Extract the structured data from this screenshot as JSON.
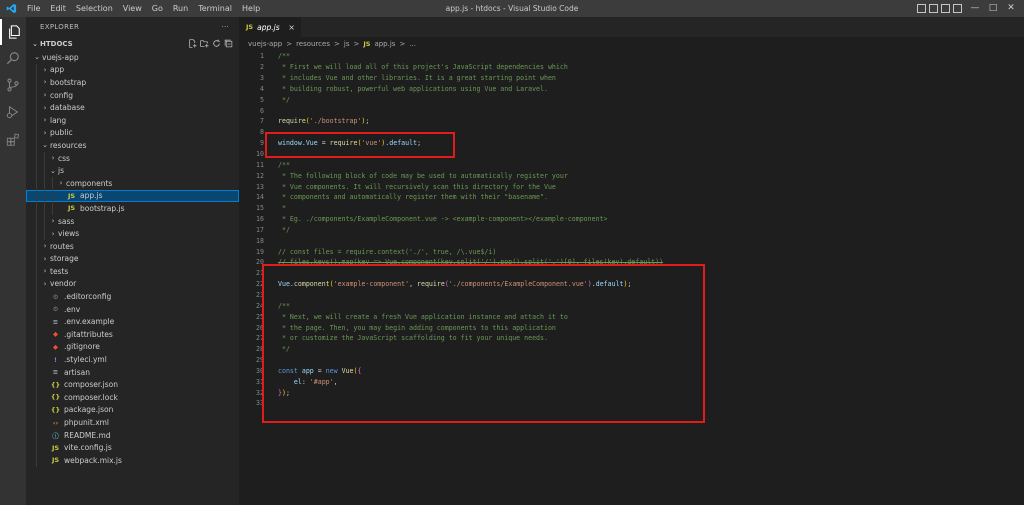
{
  "titlebar": {
    "menu": [
      "File",
      "Edit",
      "Selection",
      "View",
      "Go",
      "Run",
      "Terminal",
      "Help"
    ],
    "window_title": "app.js - htdocs - Visual Studio Code",
    "controls": [
      "—",
      "□",
      "✕"
    ]
  },
  "sidebar": {
    "header": "EXPLORER",
    "more": "···",
    "folder": "HTDOCS",
    "tree": [
      {
        "label": "vuejs-app",
        "depth": 0,
        "type": "folder",
        "open": true
      },
      {
        "label": "app",
        "depth": 1,
        "type": "folder",
        "open": false
      },
      {
        "label": "bootstrap",
        "depth": 1,
        "type": "folder",
        "open": false
      },
      {
        "label": "config",
        "depth": 1,
        "type": "folder",
        "open": false
      },
      {
        "label": "database",
        "depth": 1,
        "type": "folder",
        "open": false
      },
      {
        "label": "lang",
        "depth": 1,
        "type": "folder",
        "open": false
      },
      {
        "label": "public",
        "depth": 1,
        "type": "folder",
        "open": false
      },
      {
        "label": "resources",
        "depth": 1,
        "type": "folder",
        "open": true
      },
      {
        "label": "css",
        "depth": 2,
        "type": "folder",
        "open": false
      },
      {
        "label": "js",
        "depth": 2,
        "type": "folder",
        "open": true
      },
      {
        "label": "components",
        "depth": 3,
        "type": "folder",
        "open": false
      },
      {
        "label": "app.js",
        "depth": 3,
        "type": "js",
        "selected": true
      },
      {
        "label": "bootstrap.js",
        "depth": 3,
        "type": "js"
      },
      {
        "label": "sass",
        "depth": 2,
        "type": "folder",
        "open": false
      },
      {
        "label": "views",
        "depth": 2,
        "type": "folder",
        "open": false
      },
      {
        "label": "routes",
        "depth": 1,
        "type": "folder",
        "open": false
      },
      {
        "label": "storage",
        "depth": 1,
        "type": "folder",
        "open": false
      },
      {
        "label": "tests",
        "depth": 1,
        "type": "folder",
        "open": false
      },
      {
        "label": "vendor",
        "depth": 1,
        "type": "folder",
        "open": false
      },
      {
        "label": ".editorconfig",
        "depth": 1,
        "type": "gear"
      },
      {
        "label": ".env",
        "depth": 1,
        "type": "gear"
      },
      {
        "label": ".env.example",
        "depth": 1,
        "type": "lines"
      },
      {
        "label": ".gitattributes",
        "depth": 1,
        "type": "git"
      },
      {
        "label": ".gitignore",
        "depth": 1,
        "type": "git"
      },
      {
        "label": ".styleci.yml",
        "depth": 1,
        "type": "yml"
      },
      {
        "label": "artisan",
        "depth": 1,
        "type": "lines"
      },
      {
        "label": "composer.json",
        "depth": 1,
        "type": "json"
      },
      {
        "label": "composer.lock",
        "depth": 1,
        "type": "json"
      },
      {
        "label": "package.json",
        "depth": 1,
        "type": "json"
      },
      {
        "label": "phpunit.xml",
        "depth": 1,
        "type": "xml"
      },
      {
        "label": "README.md",
        "depth": 1,
        "type": "info"
      },
      {
        "label": "vite.config.js",
        "depth": 1,
        "type": "js"
      },
      {
        "label": "webpack.mix.js",
        "depth": 1,
        "type": "js"
      }
    ]
  },
  "editor": {
    "tab": {
      "icon": "JS",
      "label": "app.js",
      "close": "×"
    },
    "breadcrumb": [
      "vuejs-app",
      ">",
      "resources",
      ">",
      "js",
      ">",
      "JS",
      "app.js",
      ">",
      "..."
    ],
    "lines": [
      [
        [
          "c",
          "/**"
        ]
      ],
      [
        [
          "c",
          " * First we will load all of this project's JavaScript dependencies which"
        ]
      ],
      [
        [
          "c",
          " * includes Vue and other libraries. It is a great starting point when"
        ]
      ],
      [
        [
          "c",
          " * building robust, powerful web applications using Vue and Laravel."
        ]
      ],
      [
        [
          "c",
          " */"
        ]
      ],
      [],
      [
        [
          "f",
          "require"
        ],
        [
          "y",
          "("
        ],
        [
          "s",
          "'./bootstrap'"
        ],
        [
          "y",
          ")"
        ],
        [
          "p",
          ";"
        ]
      ],
      [],
      [
        [
          "v",
          "window"
        ],
        [
          "p",
          "."
        ],
        [
          "v",
          "Vue"
        ],
        [
          "p",
          " = "
        ],
        [
          "f",
          "require"
        ],
        [
          "y",
          "("
        ],
        [
          "s",
          "'vue'"
        ],
        [
          "y",
          ")"
        ],
        [
          "p",
          "."
        ],
        [
          "v",
          "default"
        ],
        [
          "p",
          ";"
        ]
      ],
      [],
      [
        [
          "c",
          "/**"
        ]
      ],
      [
        [
          "c",
          " * The following block of code may be used to automatically register your"
        ]
      ],
      [
        [
          "c",
          " * Vue components. It will recursively scan this directory for the Vue"
        ]
      ],
      [
        [
          "c",
          " * components and automatically register them with their \"basename\"."
        ]
      ],
      [
        [
          "c",
          " *"
        ]
      ],
      [
        [
          "c",
          " * Eg. ./components/ExampleComponent.vue -> <example-component></example-component>"
        ]
      ],
      [
        [
          "c",
          " */"
        ]
      ],
      [],
      [
        [
          "c",
          "// const files = require.context('./', true, /\\.vue$/i)"
        ]
      ],
      [
        [
          "cs",
          "// files.keys().map(key => Vue.component(key.split('/').pop().split('.')[0], files(key).default))"
        ]
      ],
      [],
      [
        [
          "v",
          "Vue"
        ],
        [
          "p",
          "."
        ],
        [
          "f",
          "component"
        ],
        [
          "y",
          "("
        ],
        [
          "s",
          "'example-component'"
        ],
        [
          "p",
          ", "
        ],
        [
          "f",
          "require"
        ],
        [
          "m",
          "("
        ],
        [
          "s",
          "'./components/ExampleComponent.vue'"
        ],
        [
          "m",
          ")"
        ],
        [
          "p",
          "."
        ],
        [
          "v",
          "default"
        ],
        [
          "y",
          ")"
        ],
        [
          "p",
          ";"
        ]
      ],
      [],
      [
        [
          "c",
          "/**"
        ]
      ],
      [
        [
          "c",
          " * Next, we will create a fresh Vue application instance and attach it to"
        ]
      ],
      [
        [
          "c",
          " * the page. Then, you may begin adding components to this application"
        ]
      ],
      [
        [
          "c",
          " * or customize the JavaScript scaffolding to fit your unique needs."
        ]
      ],
      [
        [
          "c",
          " */"
        ]
      ],
      [],
      [
        [
          "k",
          "const"
        ],
        [
          "p",
          " "
        ],
        [
          "v",
          "app"
        ],
        [
          "p",
          " = "
        ],
        [
          "k",
          "new"
        ],
        [
          "p",
          " "
        ],
        [
          "f",
          "Vue"
        ],
        [
          "y",
          "("
        ],
        [
          "m",
          "{"
        ]
      ],
      [
        [
          "p",
          "    "
        ],
        [
          "v",
          "el"
        ],
        [
          "p",
          ": "
        ],
        [
          "s",
          "'#app'"
        ],
        [
          "p",
          ","
        ]
      ],
      [
        [
          "m",
          "}"
        ],
        [
          "y",
          ")"
        ],
        [
          "p",
          ";"
        ]
      ],
      []
    ]
  }
}
